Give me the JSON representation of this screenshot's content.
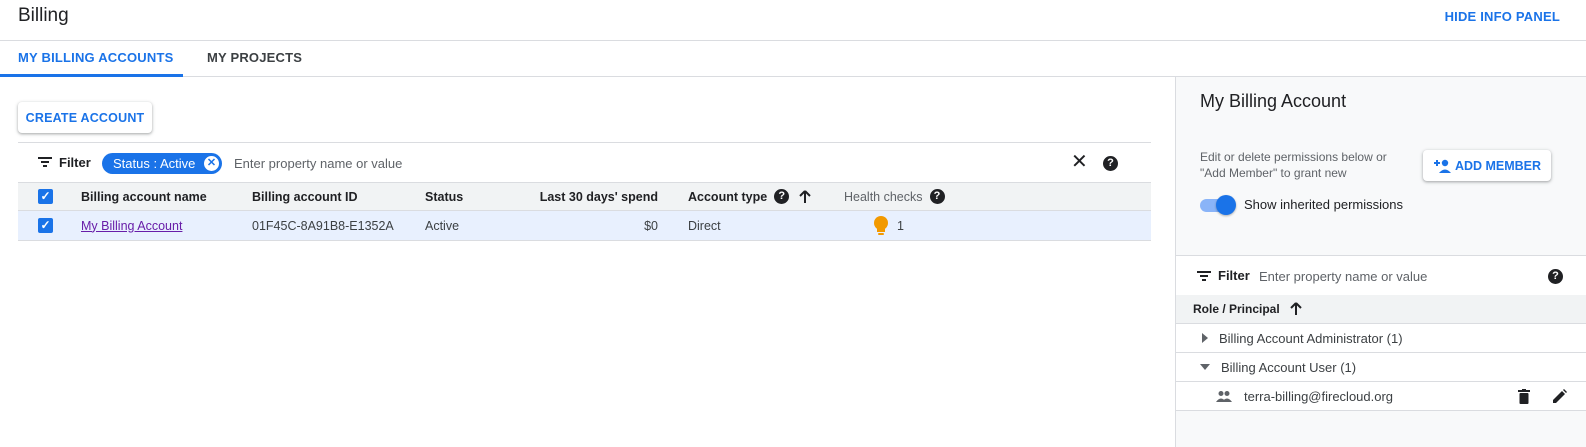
{
  "header": {
    "title": "Billing",
    "hide_info_panel": "HIDE INFO PANEL"
  },
  "tabs": [
    {
      "label": "MY BILLING ACCOUNTS",
      "active": true
    },
    {
      "label": "MY PROJECTS",
      "active": false
    }
  ],
  "main": {
    "create_account": "CREATE ACCOUNT",
    "filter_label": "Filter",
    "filter_chip": "Status : Active",
    "filter_placeholder": "Enter property name or value",
    "table": {
      "columns": [
        "Billing account name",
        "Billing account ID",
        "Status",
        "Last 30 days' spend",
        "Account type",
        "Health checks"
      ],
      "rows": [
        {
          "name": "My Billing Account",
          "id": "01F45C-8A91B8-E1352A",
          "status": "Active",
          "spend": "$0",
          "type": "Direct",
          "health": "1"
        }
      ]
    }
  },
  "panel": {
    "title": "My Billing Account",
    "description": "Edit or delete permissions below or \"Add Member\" to grant new",
    "add_member": "ADD MEMBER",
    "toggle_label": "Show inherited permissions",
    "toggle_on": true,
    "filter_label": "Filter",
    "filter_placeholder": "Enter property name or value",
    "column_header": "Role / Principal",
    "roles": [
      {
        "label": "Billing Account Administrator (1)",
        "expanded": false
      },
      {
        "label": "Billing Account User (1)",
        "expanded": true
      }
    ],
    "principal": "terra-billing@firecloud.org"
  },
  "colors": {
    "accent": "#1a73e8",
    "link_visited": "#681da8",
    "health_bulb": "#f29900"
  },
  "icons": [
    "filter-icon",
    "close-icon",
    "help-icon",
    "sort-arrow-up-icon",
    "lightbulb-icon",
    "add-person-icon",
    "expand-arrow-icon",
    "group-icon",
    "delete-icon",
    "edit-icon"
  ]
}
